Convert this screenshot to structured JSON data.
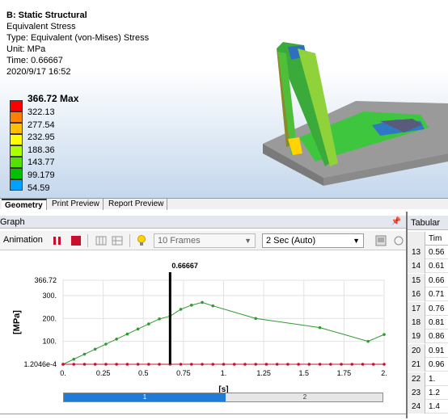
{
  "result": {
    "title": "B: Static Structural",
    "lines": [
      "Equivalent Stress",
      "Type: Equivalent (von-Mises) Stress",
      "Unit: MPa",
      "Time: 0.66667",
      "2020/9/17 16:52"
    ]
  },
  "legend": {
    "max_label": "366.72 Max",
    "labels": [
      "322.13",
      "277.54",
      "232.95",
      "188.36",
      "143.77",
      "99.179",
      "54.59"
    ],
    "colors": [
      "#ff0000",
      "#ff7f00",
      "#ffbf00",
      "#ffff00",
      "#aaff00",
      "#55e000",
      "#00c000",
      "#00a0ff"
    ]
  },
  "view_tabs": [
    "Geometry",
    "Print Preview",
    "Report Preview"
  ],
  "graph": {
    "title": "Graph",
    "animation_label": "Animation",
    "frames": "10 Frames",
    "duration": "2 Sec (Auto)",
    "timeline_segments": [
      "1",
      "2"
    ]
  },
  "chart_data": {
    "type": "line",
    "xlabel": "[s]",
    "ylabel": "[MPa]",
    "xlim": [
      0,
      2
    ],
    "ylim": [
      0.00012046,
      366.72
    ],
    "x_ticks": [
      "0.",
      "0.25",
      "0.5",
      "0.75",
      "1.",
      "1.25",
      "1.5",
      "1.75",
      "2."
    ],
    "y_ticks": [
      "1.2046e-4",
      "100.",
      "200.",
      "300.",
      "366.72"
    ],
    "y_tick_values": [
      0.00012046,
      100,
      200,
      300,
      366.72
    ],
    "current_time_label": "0.66667",
    "current_time": 0.66667,
    "series": [
      {
        "color": "#2e9b2e",
        "x": [
          0,
          0.0667,
          0.1333,
          0.2,
          0.2667,
          0.3333,
          0.4,
          0.4667,
          0.5333,
          0.6,
          0.6667,
          0.7333,
          0.8,
          0.8667,
          0.9333,
          1.2,
          1.6,
          1.9,
          2.0
        ],
        "y": [
          0,
          22,
          44,
          66,
          88,
          110,
          132,
          154,
          176,
          198,
          210,
          240,
          258,
          270,
          255,
          200,
          160,
          100,
          130
        ]
      },
      {
        "color": "#c8102e",
        "x": [
          0,
          0.0667,
          0.1333,
          0.2,
          0.2667,
          0.3333,
          0.4,
          0.4667,
          0.5333,
          0.6,
          0.6667,
          0.7333,
          0.8,
          0.8667,
          0.9333,
          1.0,
          1.0667,
          1.1333,
          1.2,
          1.2667,
          1.3333,
          1.4,
          1.4667,
          1.5333,
          1.6,
          1.6667,
          1.7333,
          1.8,
          1.8667,
          1.9333,
          2.0
        ],
        "y": [
          0.00012,
          0.00012,
          0.00012,
          0.00012,
          0.00012,
          0.00012,
          0.00012,
          0.00012,
          0.00012,
          0.00012,
          0.00012,
          0.00012,
          0.00012,
          0.00012,
          0.00012,
          0.00012,
          0.00012,
          0.00012,
          0.00012,
          0.00012,
          0.00012,
          0.00012,
          0.00012,
          0.00012,
          0.00012,
          0.00012,
          0.00012,
          0.00012,
          0.00012,
          0.00012,
          0.00012
        ]
      }
    ]
  },
  "tabular": {
    "title": "Tabular",
    "column_header": "Tim",
    "rows": [
      {
        "index": "13",
        "value": "0.56"
      },
      {
        "index": "14",
        "value": "0.61"
      },
      {
        "index": "15",
        "value": "0.66"
      },
      {
        "index": "16",
        "value": "0.71"
      },
      {
        "index": "17",
        "value": "0.76"
      },
      {
        "index": "18",
        "value": "0.81"
      },
      {
        "index": "19",
        "value": "0.86"
      },
      {
        "index": "20",
        "value": "0.91"
      },
      {
        "index": "21",
        "value": "0.96"
      },
      {
        "index": "22",
        "value": "1."
      },
      {
        "index": "23",
        "value": "1.2"
      },
      {
        "index": "24",
        "value": "1.4"
      }
    ]
  }
}
